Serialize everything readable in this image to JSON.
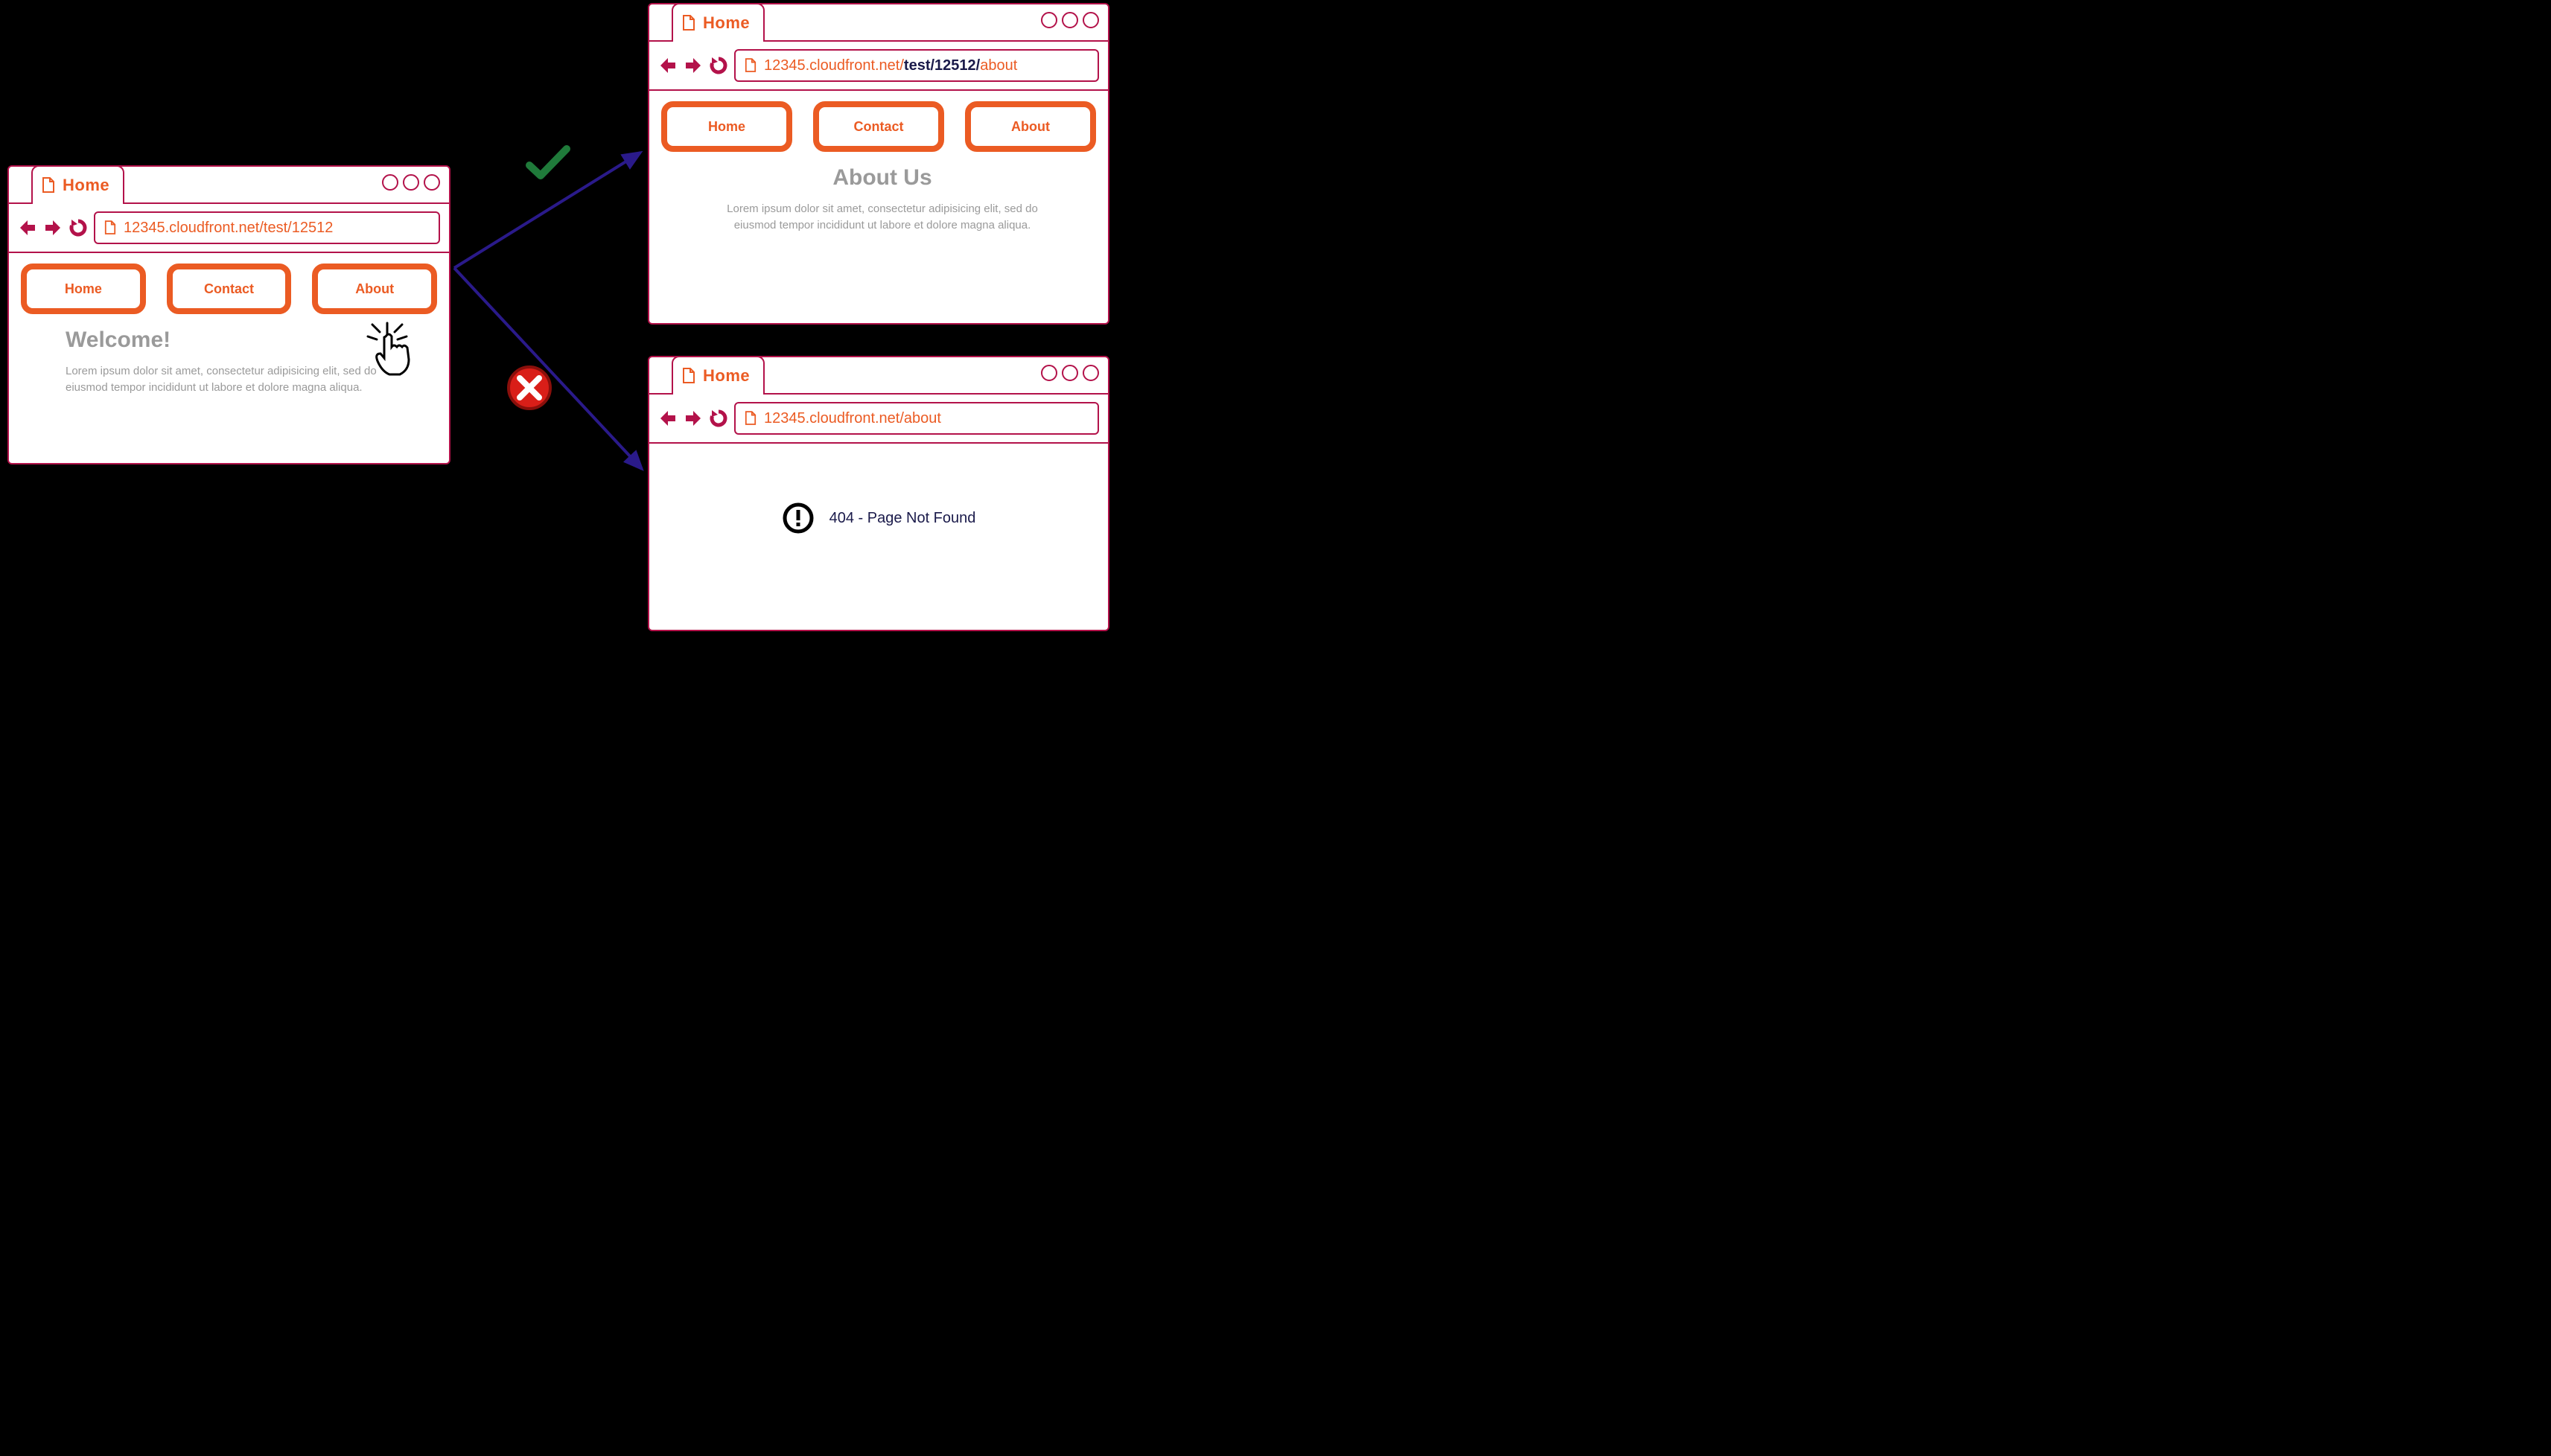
{
  "browser_left": {
    "tab_label": "Home",
    "url": "12345.cloudfront.net/test/12512",
    "nav": {
      "home": "Home",
      "contact": "Contact",
      "about": "About"
    },
    "heading": "Welcome!",
    "body": "Lorem ipsum dolor sit amet, consectetur adipisicing elit, sed do eiusmod tempor incididunt ut labore et dolore magna aliqua."
  },
  "browser_top_right": {
    "tab_label": "Home",
    "url_part1": "12345.cloudfront.net/",
    "url_part2": "test/12512/",
    "url_part3": "about",
    "nav": {
      "home": "Home",
      "contact": "Contact",
      "about": "About"
    },
    "heading": "About Us",
    "body": "Lorem ipsum dolor sit amet, consectetur adipisicing elit, sed do eiusmod tempor incididunt ut labore et dolore magna aliqua."
  },
  "browser_bottom_right": {
    "tab_label": "Home",
    "url": "12345.cloudfront.net/about",
    "error": "404 - Page Not Found"
  },
  "diagram": {
    "success_label": "success",
    "failure_label": "failure"
  }
}
